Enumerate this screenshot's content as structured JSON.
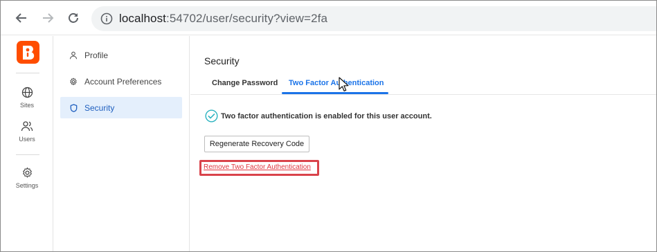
{
  "browser": {
    "url_host": "localhost",
    "url_rest": ":54702/user/security?view=2fa"
  },
  "rail": {
    "items": [
      {
        "label": "Sites",
        "icon": "globe-icon"
      },
      {
        "label": "Users",
        "icon": "users-icon"
      },
      {
        "label": "Settings",
        "icon": "gear-icon"
      }
    ]
  },
  "settings_nav": {
    "items": [
      {
        "label": "Profile",
        "icon": "person-icon"
      },
      {
        "label": "Account Preferences",
        "icon": "gear-icon"
      },
      {
        "label": "Security",
        "icon": "shield-icon",
        "active": true
      }
    ]
  },
  "main": {
    "title": "Security",
    "tabs": [
      {
        "label": "Change Password"
      },
      {
        "label": "Two Factor Authentication",
        "active": true
      }
    ],
    "status_text": "Two factor authentication is enabled for this user account.",
    "regenerate_button": "Regenerate Recovery Code",
    "remove_link": "Remove Two Factor Authentication"
  },
  "colors": {
    "brand": "#ff4d00",
    "accent": "#1a73e8",
    "success": "#2bb3c0",
    "danger": "#e0353f",
    "active_bg": "#e4effc"
  }
}
